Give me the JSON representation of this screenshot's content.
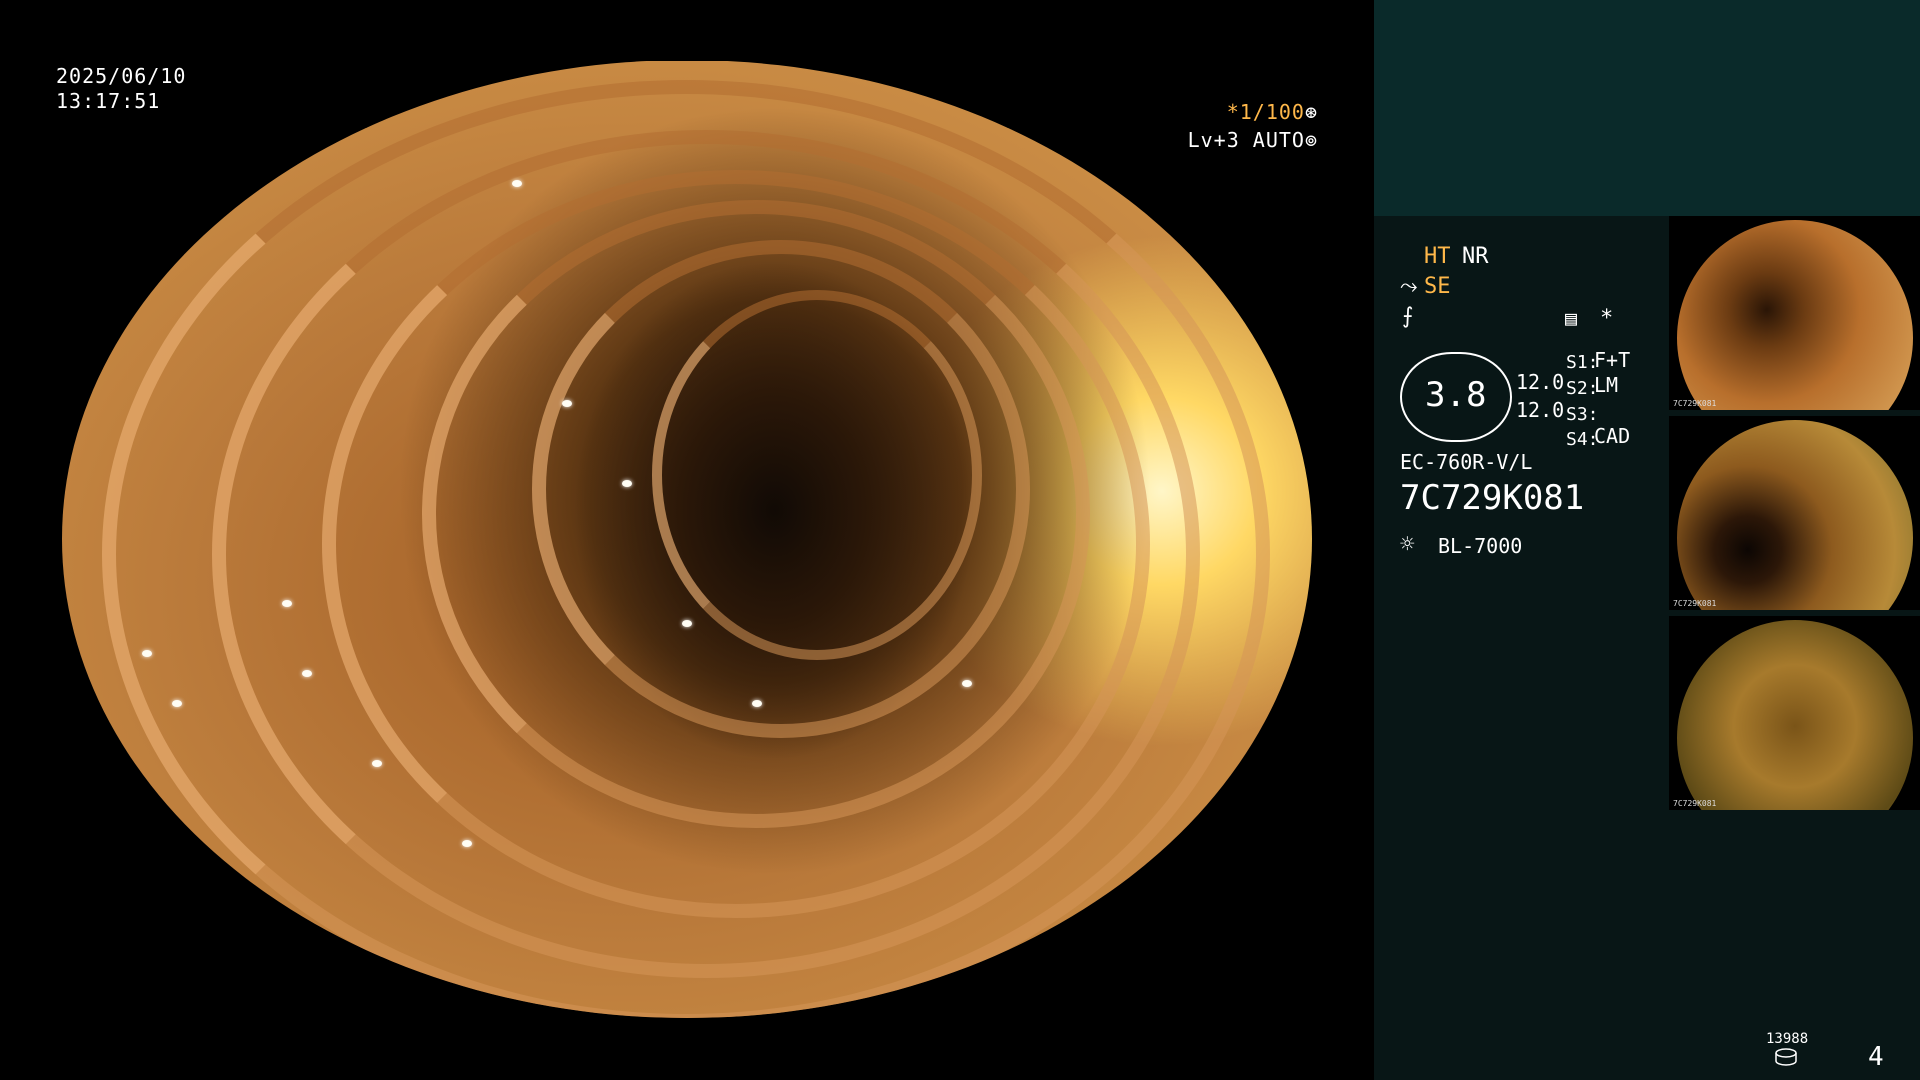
{
  "overlay": {
    "date": "2025/06/10",
    "time": "13:17:51",
    "shutter": "*1/100",
    "level": "Lv+3 AUTO"
  },
  "panel": {
    "ht": "HT",
    "nr": "NR",
    "se": "SE",
    "ring_value": "3.8",
    "val1": "12.0",
    "val2": "12.0",
    "s1": "S1:",
    "s1_val": "F+T",
    "s2": "S2:",
    "s2_val": "LM",
    "s3": "S3:",
    "s3_val": "",
    "s4": "S4:",
    "s4_val": "CAD",
    "scope_model": "EC-760R-V/L",
    "scope_serial": "7C729K081",
    "light_source": "BL-7000",
    "star": "*"
  },
  "thumbnails": [
    {
      "label": "7C729K081"
    },
    {
      "label": "7C729K081"
    },
    {
      "label": "7C729K081"
    }
  ],
  "footer": {
    "counter": "13988",
    "page": "4"
  },
  "colors": {
    "accent": "#ffb84a",
    "panel_bg": "#081616",
    "panel_top_bg": "#0a2a2a"
  }
}
